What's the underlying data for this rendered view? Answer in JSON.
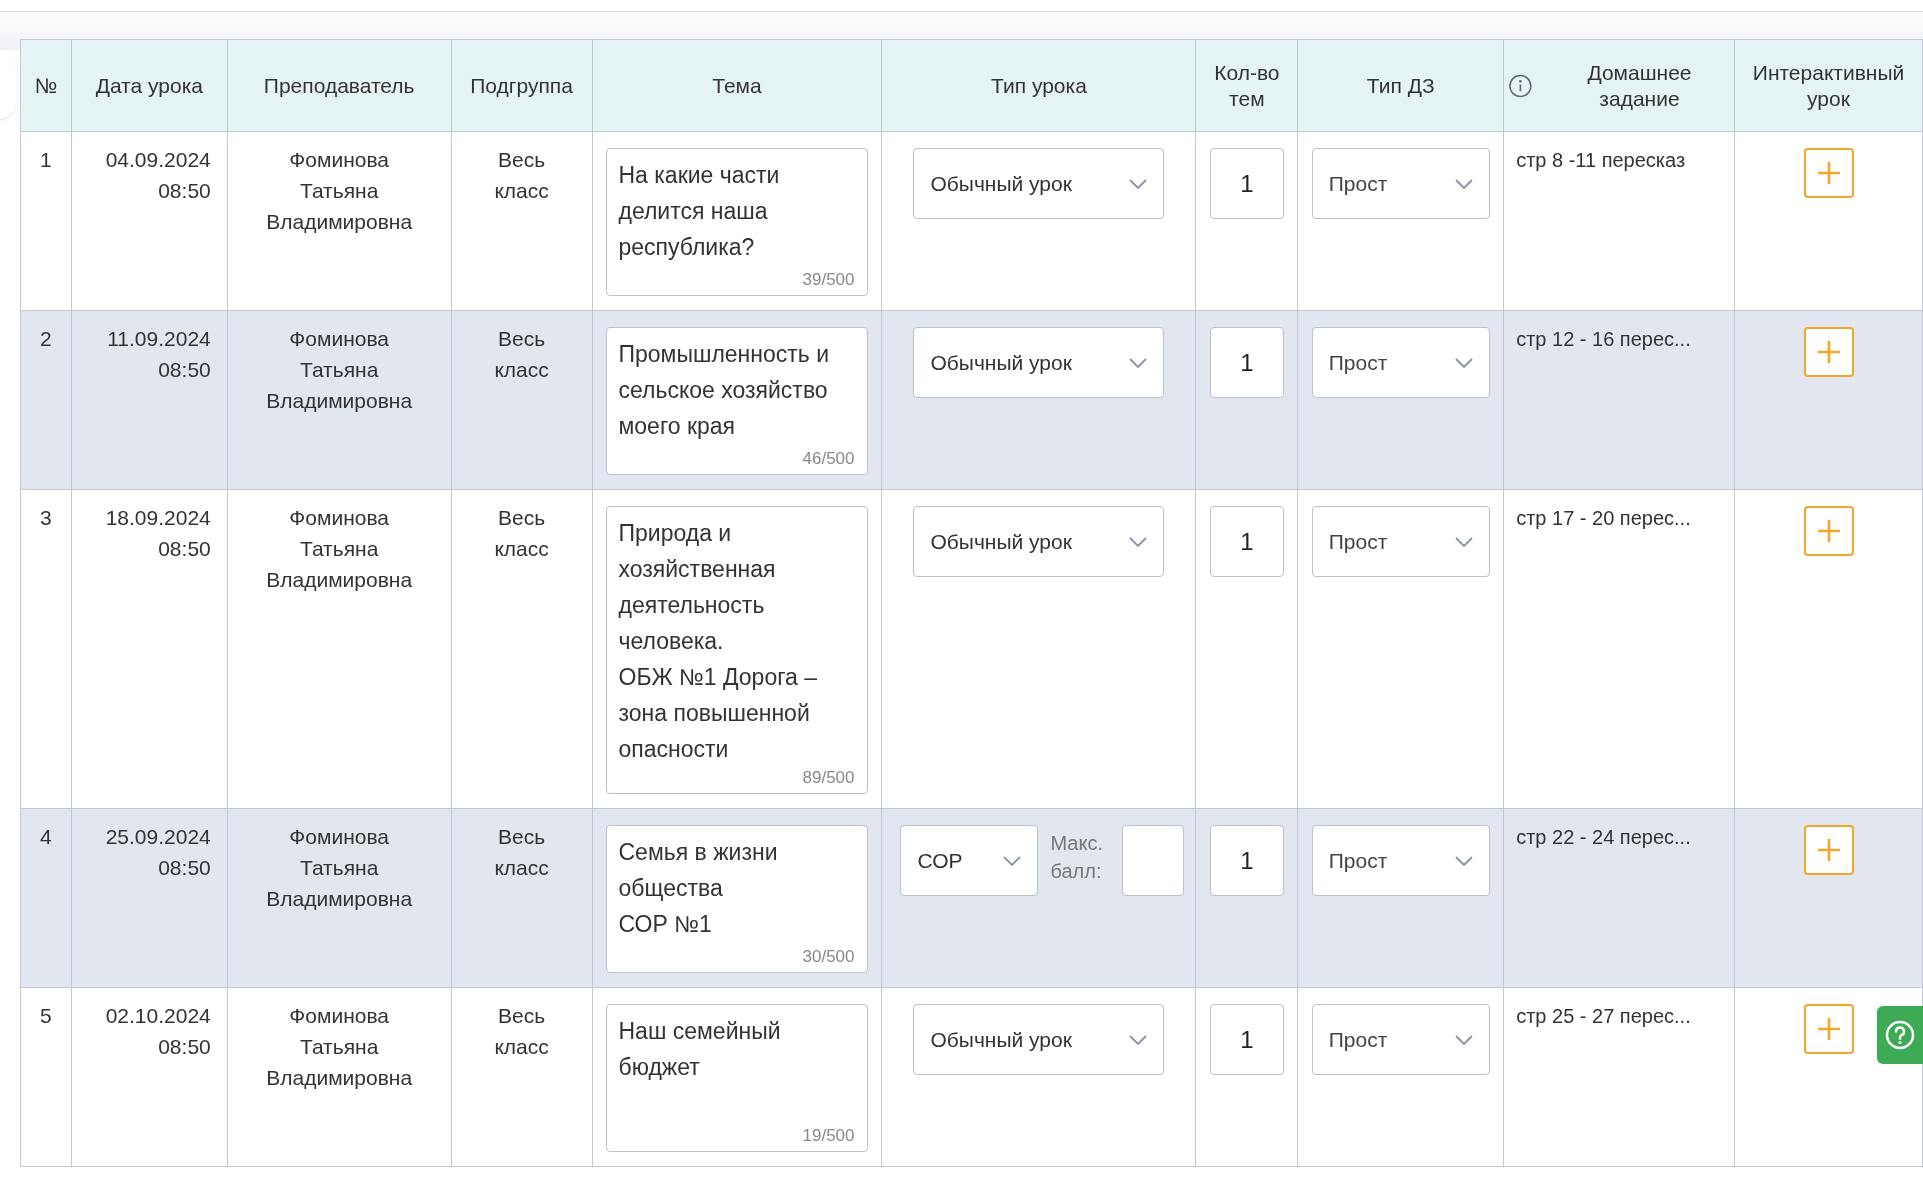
{
  "table": {
    "columns": [
      {
        "label": "№"
      },
      {
        "label": "Дата урока"
      },
      {
        "label": "Преподаватель"
      },
      {
        "label": "Подгруппа"
      },
      {
        "label": "Тема"
      },
      {
        "label": "Тип урока"
      },
      {
        "label": "Кол-во тем"
      },
      {
        "label": "Тип ДЗ"
      },
      {
        "label": "Домашнее задание",
        "info": true
      },
      {
        "label": "Интерактивный урок"
      }
    ],
    "rows": [
      {
        "num": "1",
        "date": "04.09.2024",
        "time": "08:50",
        "teacher": "Фоминова Татьяна Владимировна",
        "group": "Весь класс",
        "topic": "На какие части делится наша республика?",
        "counter": "39/500",
        "lesson_type": {
          "kind": "select",
          "value": "Обычный урок"
        },
        "topics_count": "1",
        "hw_type": "Прост",
        "homework": "стр 8 -11 пересказ"
      },
      {
        "num": "2",
        "date": "11.09.2024",
        "time": "08:50",
        "teacher": "Фоминова Татьяна Владимировна",
        "group": "Весь класс",
        "topic": "Промышленность и сельское хозяйство моего края",
        "counter": "46/500",
        "lesson_type": {
          "kind": "select",
          "value": "Обычный урок"
        },
        "topics_count": "1",
        "hw_type": "Прост",
        "homework": "стр 12 - 16 перес..."
      },
      {
        "num": "3",
        "date": "18.09.2024",
        "time": "08:50",
        "teacher": "Фоминова Татьяна Владимировна",
        "group": "Весь класс",
        "topic": "Природа и хозяйственная деятельность человека.\nОБЖ №1 Дорога – зона повышенной опасности",
        "counter": "89/500",
        "lesson_type": {
          "kind": "select",
          "value": "Обычный урок"
        },
        "topics_count": "1",
        "hw_type": "Прост",
        "homework": "стр 17 - 20 перес..."
      },
      {
        "num": "4",
        "date": "25.09.2024",
        "time": "08:50",
        "teacher": "Фоминова Татьяна Владимировна",
        "group": "Весь класс",
        "topic": "Семья в жизни общества\nСОР №1",
        "counter": "30/500",
        "lesson_type": {
          "kind": "assessment",
          "value": "СОР",
          "max_label": "Макс. балл:"
        },
        "topics_count": "1",
        "hw_type": "Прост",
        "homework": "стр 22 - 24 перес..."
      },
      {
        "num": "5",
        "date": "02.10.2024",
        "time": "08:50",
        "teacher": "Фоминова Татьяна Владимировна",
        "group": "Весь класс",
        "topic": "Наш семейный бюджет",
        "counter": "19/500",
        "lesson_type": {
          "kind": "select",
          "value": "Обычный урок"
        },
        "topics_count": "1",
        "hw_type": "Прост",
        "homework": "стр 25 - 27 перес..."
      }
    ]
  }
}
